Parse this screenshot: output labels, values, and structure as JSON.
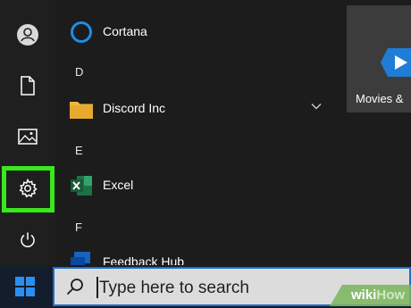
{
  "rail": {
    "icons": [
      "user-icon",
      "document-icon",
      "pictures-icon",
      "gear-icon",
      "power-icon"
    ],
    "highlight_color": "#39e81d"
  },
  "app_list": {
    "groups": [
      {
        "letter": "",
        "apps": [
          {
            "label": "Cortana",
            "icon": "cortana-icon"
          }
        ]
      },
      {
        "letter": "D",
        "apps": [
          {
            "label": "Discord Inc",
            "icon": "folder-icon",
            "expandable": true
          }
        ]
      },
      {
        "letter": "E",
        "apps": [
          {
            "label": "Excel",
            "icon": "excel-icon"
          }
        ]
      },
      {
        "letter": "F",
        "apps": [
          {
            "label": "Feedback Hub",
            "icon": "feedback-icon"
          }
        ]
      }
    ]
  },
  "tiles": {
    "movies_label": "Movies &"
  },
  "taskbar": {
    "search_placeholder": "Type here to search",
    "accent": "#1d6fc9"
  },
  "watermark": {
    "prefix": "wiki",
    "suffix": "How"
  }
}
